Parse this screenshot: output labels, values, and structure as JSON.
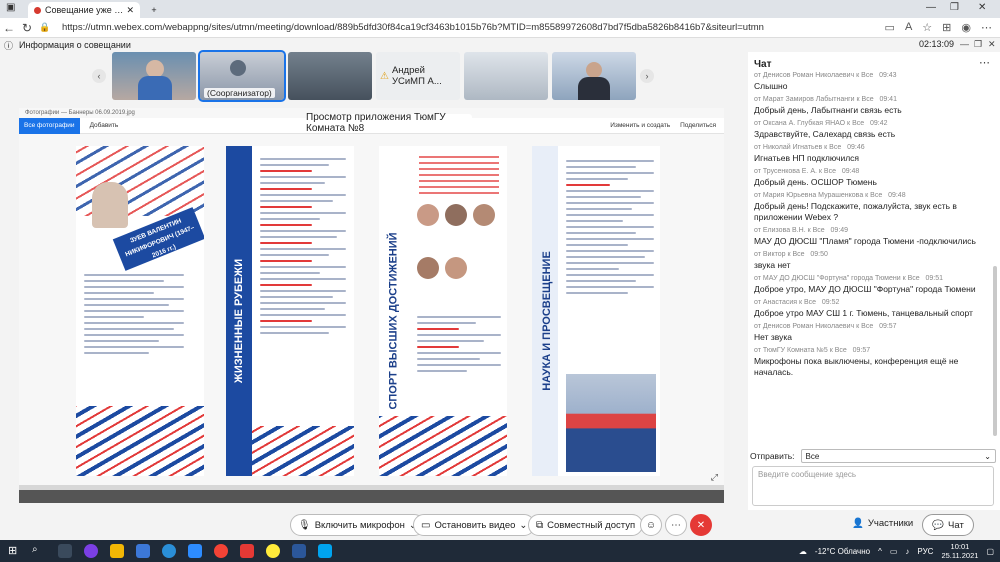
{
  "browser": {
    "tab_title": "Совещание уже проводи",
    "url": "https://utmn.webex.com/webappng/sites/utmn/meeting/download/889b5dfd30f84ca19cf3463b1015b76b?MTID=m85589972608d7bd7f5dba5826b8416b7&siteurl=utmn",
    "new_tab_symbol": "+"
  },
  "meeting": {
    "info_label": "Информация о совещании",
    "time": "02:13:09"
  },
  "participants_strip": {
    "cohost_label": "(Соорганизатор)",
    "named_tile": "Андрей УСиМП А..."
  },
  "share": {
    "banner": "Просмотр приложения ТюмГУ Комната №8",
    "viewer_file": "Фотографии — Баннеры 06.09.2019.jpg",
    "viewer_all_photos": "Все фотографии",
    "viewer_add": "Добавить",
    "viewer_edit": "Изменить и создать",
    "viewer_share": "Поделиться",
    "panel_titles": [
      "ЖИЗНЕННЫЕ РУБЕЖИ",
      "СПОРТ ВЫСШИХ ДОСТИЖЕНИЙ",
      "НАУКА И ПРОСВЕЩЕНИЕ"
    ],
    "portrait_caption": "ЗУЕВ ВАЛЕНТИН НИКИФОРОВИЧ (1947–2016 гг.)"
  },
  "chat": {
    "title": "Чат",
    "messages": [
      {
        "from": "от Денисов Роман Николаевич к Все",
        "time": "09:43",
        "text": "Слышно"
      },
      {
        "from": "от Марат Замиров Лабытнанги к Все",
        "time": "09:41",
        "text": "Добрый день, Лабытнанги связь есть"
      },
      {
        "from": "от Оксана А. Глубкая ЯНАО к Все",
        "time": "09:42",
        "text": "Здравствуйте, Салехард связь есть"
      },
      {
        "from": "от Николай Игнатьев к Все",
        "time": "09:46",
        "text": "Игнатьев НП подключился"
      },
      {
        "from": "от Трусенкова Е. А. к Все",
        "time": "09:48",
        "text": "Добрый день. ОСШОР Тюмень"
      },
      {
        "from": "от Мария Юрьевна Мурашенкова к Все",
        "time": "09:48",
        "text": "Добрый день! Подскажите, пожалуйста, звук есть в приложении Webex ?"
      },
      {
        "from": "от Елизова В.Н. к Все",
        "time": "09:49",
        "text": "МАУ ДО ДЮСШ \"Пламя\" города Тюмени -подключились"
      },
      {
        "from": "от Виктор к Все",
        "time": "09:50",
        "text": "звука нет"
      },
      {
        "from": "от МАУ ДО ДЮСШ \"Фортуна\" города Тюмени к Все",
        "time": "09:51",
        "text": "Доброе утро, МАУ ДО ДЮСШ \"Фортуна\" города Тюмени"
      },
      {
        "from": "от Анастасия к Все",
        "time": "09:52",
        "text": "Доброе утро  МАУ СШ 1 г. Тюмень, танцевальный спорт"
      },
      {
        "from": "от Денисов Роман Николаевич к Все",
        "time": "09:57",
        "text": "Нет звука"
      },
      {
        "from": "от ТюмГУ Комната №5 к Все",
        "time": "09:57",
        "text": "Микрофоны пока выключены, конференция ещё не началась."
      }
    ],
    "send_label": "Отправить:",
    "send_target": "Все",
    "input_placeholder": "Введите сообщение здесь"
  },
  "controls": {
    "mic": "Включить микрофон",
    "video": "Остановить видео",
    "share": "Совместный доступ",
    "participants": "Участники",
    "chat": "Чат"
  },
  "taskbar": {
    "weather": "-12°C  Облачно",
    "lang": "РУС",
    "time": "10:01",
    "date": "25.11.2021"
  },
  "colors": {
    "accent": "#1a73e8",
    "end_call": "#e53935",
    "banner_blue": "#1c4aa1"
  }
}
